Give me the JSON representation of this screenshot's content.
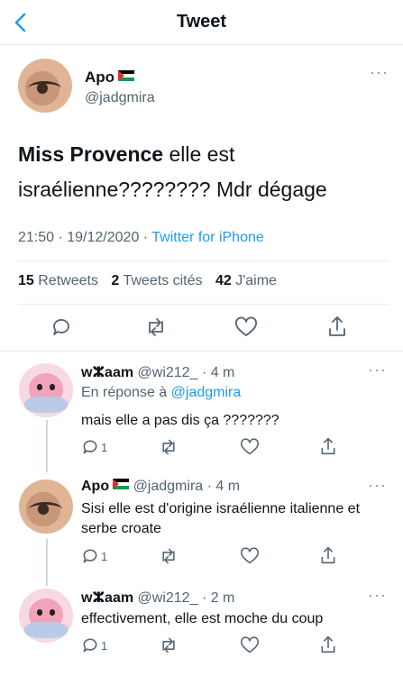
{
  "header": {
    "title": "Tweet"
  },
  "tweet": {
    "author_name": "Apo",
    "handle": "@jadgmira",
    "text_bold": "Miss Provence",
    "text_rest": " elle est israélienne???????? Mdr dégage",
    "time": "21:50 · 19/12/2020 · ",
    "source": "Twitter for iPhone",
    "retweets_count": "15",
    "retweets_label": "Retweets",
    "quotes_count": "2",
    "quotes_label": "Tweets cités",
    "likes_count": "42",
    "likes_label": "J'aime"
  },
  "replies": [
    {
      "name": "wⵣaam",
      "handle": "@wi212_",
      "time": "· 4 m",
      "reply_to_label": "En réponse à",
      "reply_to_handle": "@jadgmira",
      "text": "mais elle a pas dis ça ???????",
      "reply_count": "1"
    },
    {
      "name": "Apo",
      "handle": "@jadgmira",
      "time": "· 4 m",
      "text": "Sisi elle est d'origine israélienne italienne et serbe croate",
      "reply_count": "1"
    },
    {
      "name": "wⵣaam",
      "handle": "@wi212_",
      "time": "· 2 m",
      "text": "effectivement, elle est moche du coup",
      "reply_count": "1"
    }
  ],
  "icons": {
    "back": "chevron-left-icon",
    "more": "more-icon",
    "reply": "reply-icon",
    "retweet": "retweet-icon",
    "like": "heart-icon",
    "share": "share-icon"
  },
  "colors": {
    "accent": "#1d9bf0",
    "secondary_text": "#536471"
  }
}
